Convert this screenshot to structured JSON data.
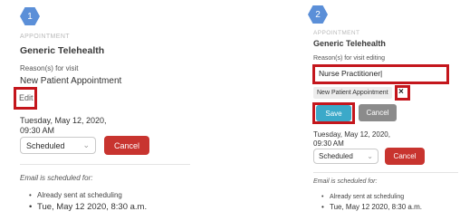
{
  "panel1": {
    "step": "1",
    "section_label": "APPOINTMENT",
    "title": "Generic Telehealth",
    "reason_label": "Reason(s) for visit",
    "reason_value": "New Patient Appointment",
    "edit_link": "Edit",
    "date_line1": "Tuesday, May 12, 2020,",
    "date_line2": "09:30 AM",
    "status_select": "Scheduled",
    "cancel_button": "Cancel",
    "email_note": "Email is scheduled for:",
    "email_items": [
      "Already sent at scheduling",
      "Tue, May 12 2020, 8:30 a.m."
    ]
  },
  "panel2": {
    "step": "2",
    "section_label": "APPOINTMENT",
    "title": "Generic Telehealth",
    "reason_label": "Reason(s) for visit editing",
    "reason_input_value": "Nurse Practitioner",
    "chip_label": "New Patient Appointment",
    "chip_remove": "×",
    "save_button": "Save",
    "cancel_button": "Cancel",
    "date_line1": "Tuesday, May 12, 2020,",
    "date_line2": "09:30 AM",
    "status_select": "Scheduled",
    "cancel_button_2": "Cancel",
    "email_note": "Email is scheduled for:",
    "email_items": [
      "Already sent at scheduling",
      "Tue, May 12 2020, 8:30 a.m."
    ]
  },
  "colors": {
    "step_badge": "#5b8fd8",
    "highlight_red": "#c4161c",
    "cancel_red": "#c8342f",
    "save_teal": "#3ba9c9",
    "secondary_gray": "#8b8b8b"
  }
}
